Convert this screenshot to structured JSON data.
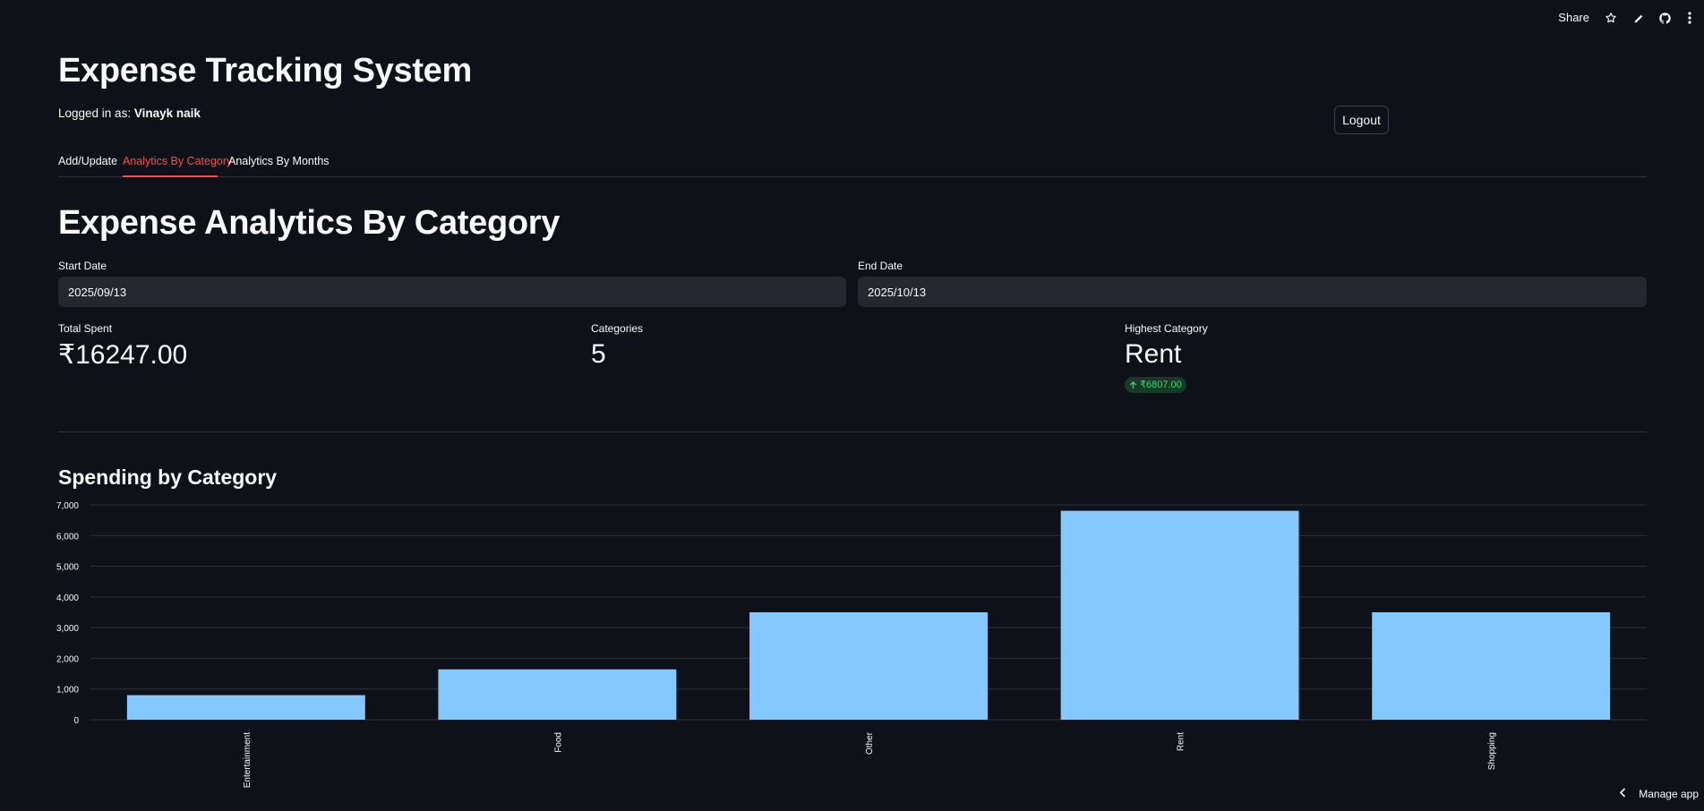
{
  "toolbar": {
    "share_label": "Share",
    "icons": [
      "star-icon",
      "pencil-icon",
      "github-icon",
      "more-vert-icon"
    ]
  },
  "header": {
    "title": "Expense Tracking System",
    "logged_in_prefix": "Logged in as: ",
    "username": "Vinayk naik",
    "logout_label": "Logout"
  },
  "tabs": [
    {
      "label": "Add/Update",
      "active": false
    },
    {
      "label": "Analytics By Category",
      "active": true
    },
    {
      "label": "Analytics By Months",
      "active": false
    }
  ],
  "accent_color": "#ff4b4b",
  "page": {
    "title": "Expense Analytics By Category",
    "start_date_label": "Start Date",
    "start_date_value": "2025/09/13",
    "end_date_label": "End Date",
    "end_date_value": "2025/10/13"
  },
  "metrics": [
    {
      "label": "Total Spent",
      "value": "₹16247.00"
    },
    {
      "label": "Categories",
      "value": "5"
    },
    {
      "label": "Highest Category",
      "value": "Rent",
      "delta": "₹6807.00"
    }
  ],
  "chart_data": {
    "type": "bar",
    "title": "Spending by Category",
    "categories": [
      "Entertainment",
      "Food",
      "Other",
      "Rent",
      "Shopping"
    ],
    "values": [
      800,
      1640,
      3500,
      6807,
      3500
    ],
    "yticks": [
      "0",
      "1,000",
      "2,000",
      "3,000",
      "4,000",
      "5,000",
      "6,000",
      "7,000"
    ],
    "ylim": [
      0,
      7000
    ],
    "bar_color": "#83c9ff",
    "grid": true
  },
  "footer": {
    "manage_label": "Manage app"
  }
}
